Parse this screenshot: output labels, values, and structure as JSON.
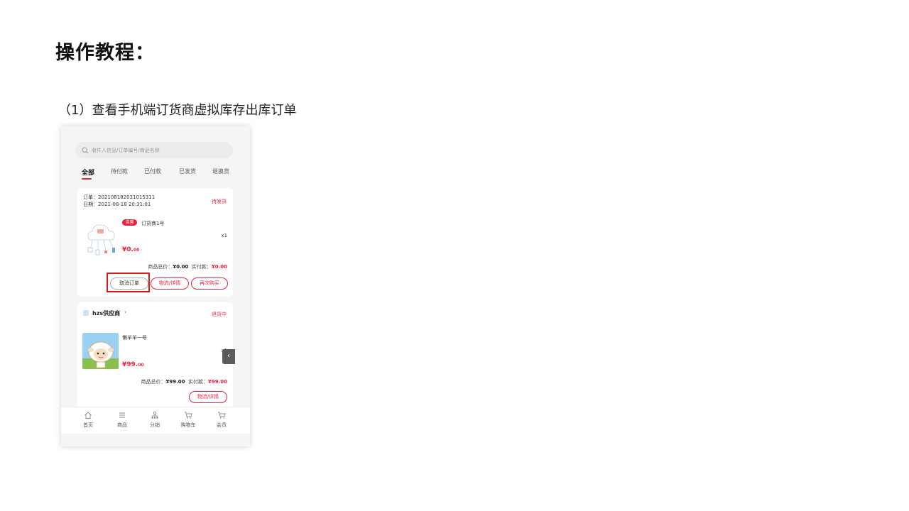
{
  "heading": "操作教程：",
  "step1": "（1）查看手机端订货商虚拟库存出库订单",
  "colors": {
    "accent": "#e8233f",
    "highlight_box": "#d61c1c"
  },
  "search": {
    "placeholder": "收件人信息/订单编号/商品名称",
    "icon": "search-icon"
  },
  "tabs": [
    "全部",
    "待付款",
    "已付款",
    "已发货",
    "退换货"
  ],
  "order1": {
    "order_no": "订单：202108182031015311",
    "date": "日期：2021-08-18 20:31:01",
    "status": "待发货",
    "badge": "自营",
    "product_name": "订货商1号",
    "qty": "x1",
    "price_int": "¥0.",
    "price_dec": "00",
    "total_label": "商品总价：",
    "total_value": "¥0.00",
    "paid_label": "实付款：",
    "paid_value": "¥0.00",
    "btn_cancel": "取消订单",
    "btn_logistics": "物流/详情",
    "btn_rebuy": "再次购买"
  },
  "order2": {
    "supplier": "hzs供应商",
    "supplier_arrow": "›",
    "status": "退货中",
    "product_name": "懒羊羊一号",
    "qty": "x1",
    "price_int": "¥99.",
    "price_dec": "00",
    "total_label": "商品总价：",
    "total_value": "¥99.00",
    "paid_label": "实付款：",
    "paid_value": "¥99.00",
    "btn_logistics": "物流/详情"
  },
  "side_toggle": "‹",
  "bottom_nav": [
    {
      "label": "首页",
      "icon": "home-icon"
    },
    {
      "label": "商品",
      "icon": "list-icon"
    },
    {
      "label": "分销",
      "icon": "distribution-icon"
    },
    {
      "label": "购物车",
      "icon": "cart-icon"
    },
    {
      "label": "会员",
      "icon": "member-icon"
    }
  ]
}
